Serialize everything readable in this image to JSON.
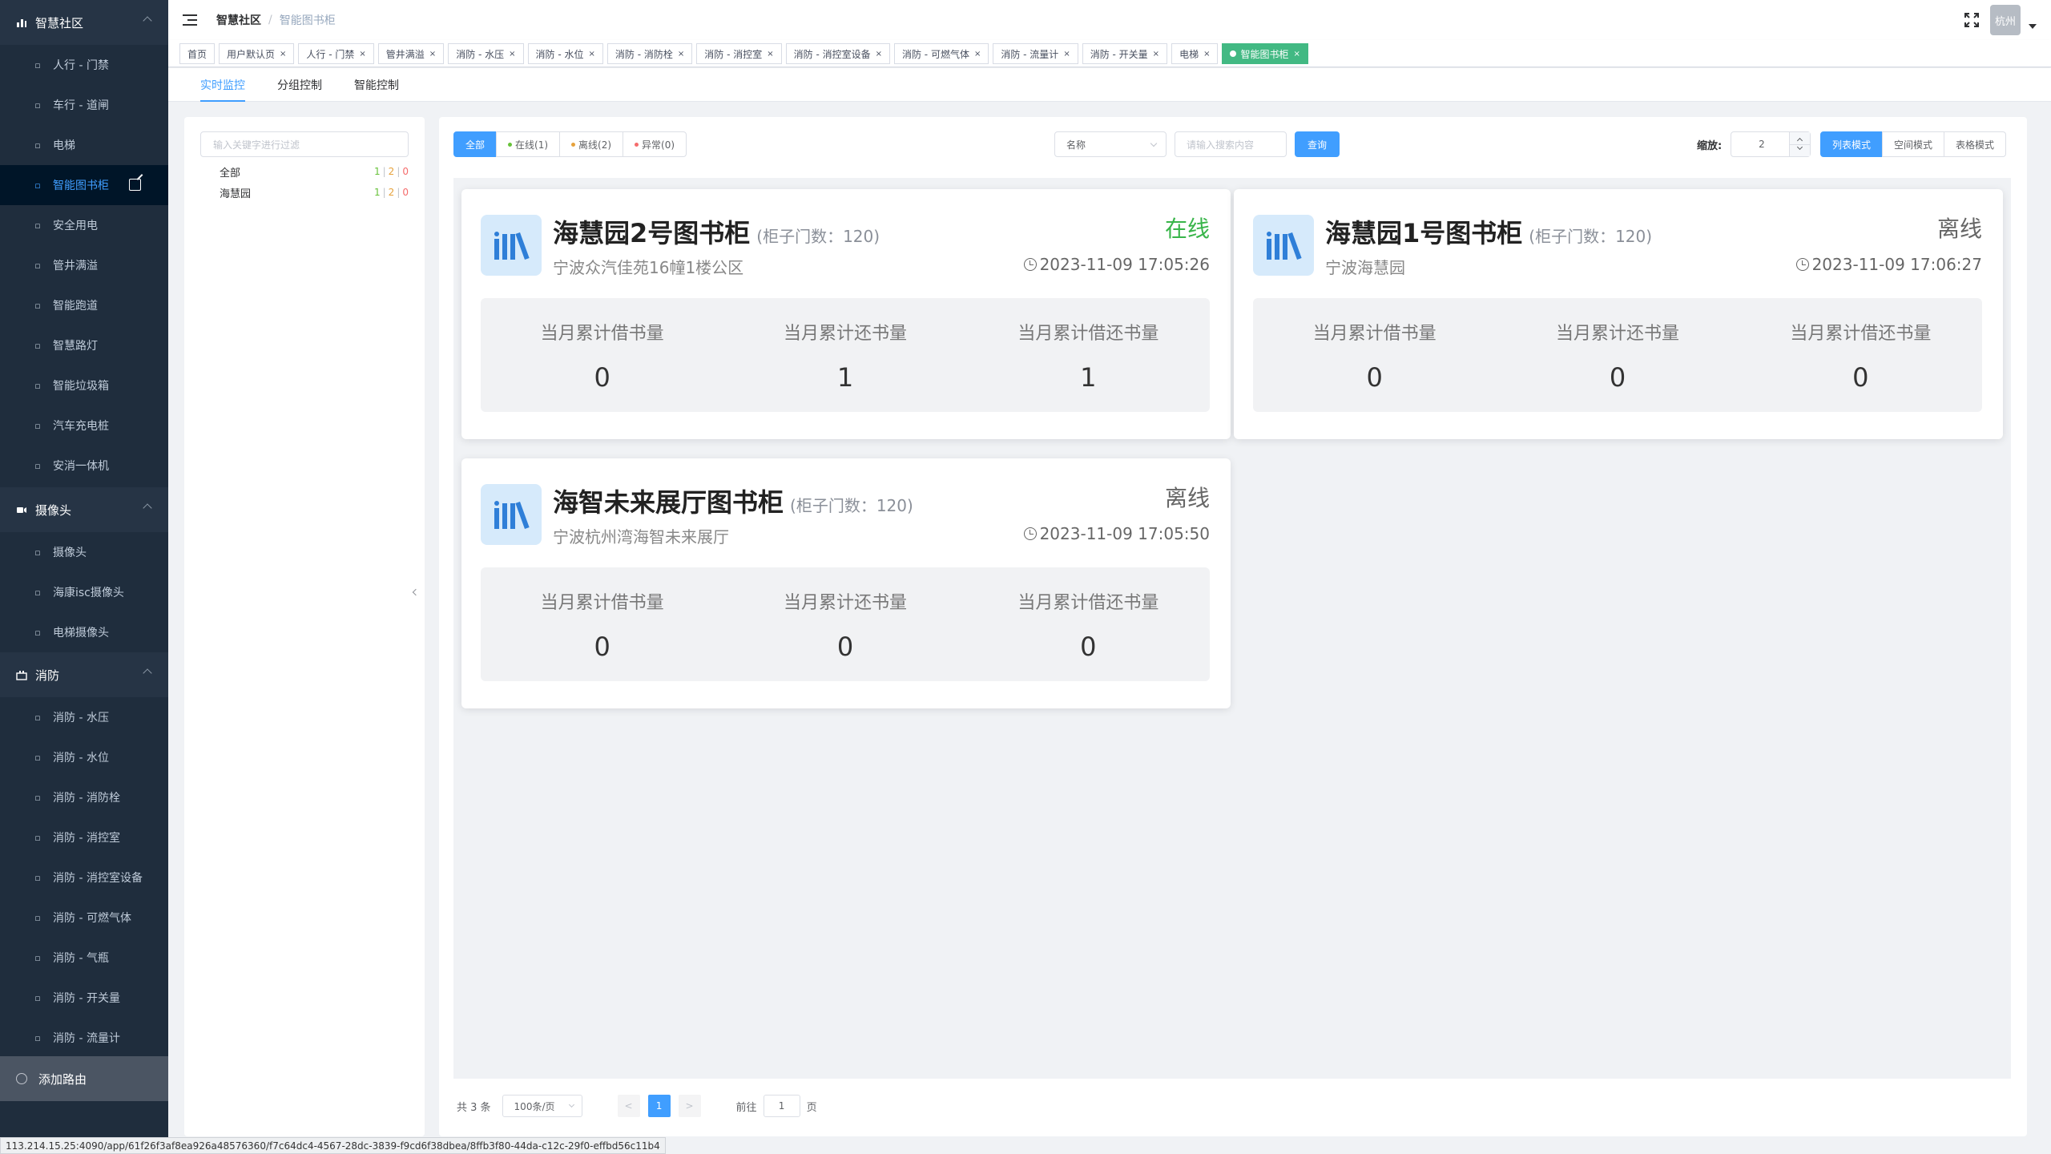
{
  "sidebar": {
    "groups": [
      {
        "label": "智慧社区",
        "icon": "bar-chart-icon"
      },
      {
        "label": "摄像头",
        "icon": "camera-icon"
      },
      {
        "label": "消防",
        "icon": "fire-icon"
      }
    ],
    "community_items": [
      {
        "label": "人行 - 门禁",
        "icon": "pedestrian-icon"
      },
      {
        "label": "车行 - 道闸",
        "icon": "car-icon"
      },
      {
        "label": "电梯",
        "icon": "elevator-icon"
      },
      {
        "label": "智能图书柜",
        "icon": "books-icon"
      },
      {
        "label": "安全用电",
        "icon": "plug-icon"
      },
      {
        "label": "管井满溢",
        "icon": "well-icon"
      },
      {
        "label": "智能跑道",
        "icon": "runner-icon"
      },
      {
        "label": "智慧路灯",
        "icon": "lamp-icon"
      },
      {
        "label": "智能垃圾箱",
        "icon": "trash-icon"
      },
      {
        "label": "汽车充电桩",
        "icon": "charger-icon"
      },
      {
        "label": "安消一体机",
        "icon": "device-icon"
      }
    ],
    "camera_items": [
      {
        "label": "摄像头",
        "icon": "camera-icon"
      },
      {
        "label": "海康isc摄像头",
        "icon": "camera-icon"
      },
      {
        "label": "电梯摄像头",
        "icon": "elevator-icon"
      }
    ],
    "fire_items": [
      {
        "label": "消防 - 水压",
        "icon": "gauge-icon"
      },
      {
        "label": "消防 - 水位",
        "icon": "water-level-icon"
      },
      {
        "label": "消防 - 消防栓",
        "icon": "hydrant-icon"
      },
      {
        "label": "消防 - 消控室",
        "icon": "home-icon"
      },
      {
        "label": "消防 - 消控室设备",
        "icon": "home-icon"
      },
      {
        "label": "消防 - 可燃气体",
        "icon": "gas-icon"
      },
      {
        "label": "消防 - 气瓶",
        "icon": "cylinder-icon"
      },
      {
        "label": "消防 - 开关量",
        "icon": "switch-icon"
      },
      {
        "label": "消防 - 流量计",
        "icon": "flow-icon"
      }
    ],
    "add_route": "添加路由"
  },
  "navbar": {
    "breadcrumb_root": "智慧社区",
    "breadcrumb_current": "智能图书柜",
    "avatar_text": "杭州"
  },
  "tags": [
    {
      "label": "首页",
      "closable": false
    },
    {
      "label": "用户默认页",
      "closable": true
    },
    {
      "label": "人行 - 门禁",
      "closable": true
    },
    {
      "label": "管井满溢",
      "closable": true
    },
    {
      "label": "消防 - 水压",
      "closable": true
    },
    {
      "label": "消防 - 水位",
      "closable": true
    },
    {
      "label": "消防 - 消防栓",
      "closable": true
    },
    {
      "label": "消防 - 消控室",
      "closable": true
    },
    {
      "label": "消防 - 消控室设备",
      "closable": true
    },
    {
      "label": "消防 - 可燃气体",
      "closable": true
    },
    {
      "label": "消防 - 流量计",
      "closable": true
    },
    {
      "label": "消防 - 开关量",
      "closable": true
    },
    {
      "label": "电梯",
      "closable": true
    },
    {
      "label": "智能图书柜",
      "closable": true,
      "active": true
    }
  ],
  "subtabs": [
    "实时监控",
    "分组控制",
    "智能控制"
  ],
  "tree": {
    "filter_placeholder": "输入关键字进行过滤",
    "nodes": [
      {
        "label": "全部",
        "online": "1",
        "offline": "2",
        "error": "0"
      },
      {
        "label": "海慧园",
        "online": "1",
        "offline": "2",
        "error": "0"
      }
    ]
  },
  "toolbar": {
    "status_filters": [
      {
        "label": "全部",
        "active": true
      },
      {
        "label": "在线(1)",
        "dot": "#67c23a"
      },
      {
        "label": "离线(2)",
        "dot": "#e6a23c"
      },
      {
        "label": "异常(0)",
        "dot": "#f56c6c"
      }
    ],
    "field_select": "名称",
    "search_placeholder": "请输入搜索内容",
    "query_button": "查询",
    "zoom_label": "缩放:",
    "zoom_value": "2",
    "modes": [
      {
        "label": "列表模式",
        "active": true
      },
      {
        "label": "空间模式"
      },
      {
        "label": "表格模式"
      }
    ]
  },
  "cards": [
    {
      "name": "海慧园2号图书柜",
      "doors": "(柜子门数：120)",
      "address": "宁波众汽佳苑16幢1楼公区",
      "status": "在线",
      "online": true,
      "time": "2023-11-09 17:05:26",
      "stats": [
        {
          "label": "当月累计借书量",
          "value": "0"
        },
        {
          "label": "当月累计还书量",
          "value": "1"
        },
        {
          "label": "当月累计借还书量",
          "value": "1"
        }
      ]
    },
    {
      "name": "海慧园1号图书柜",
      "doors": "(柜子门数：120)",
      "address": "宁波海慧园",
      "status": "离线",
      "online": false,
      "time": "2023-11-09 17:06:27",
      "stats": [
        {
          "label": "当月累计借书量",
          "value": "0"
        },
        {
          "label": "当月累计还书量",
          "value": "0"
        },
        {
          "label": "当月累计借还书量",
          "value": "0"
        }
      ]
    },
    {
      "name": "海智未来展厅图书柜",
      "doors": "(柜子门数：120)",
      "address": "宁波杭州湾海智未来展厅",
      "status": "离线",
      "online": false,
      "time": "2023-11-09 17:05:50",
      "stats": [
        {
          "label": "当月累计借书量",
          "value": "0"
        },
        {
          "label": "当月累计还书量",
          "value": "0"
        },
        {
          "label": "当月累计借还书量",
          "value": "0"
        }
      ]
    }
  ],
  "pagination": {
    "total": "共 3 条",
    "page_size": "100条/页",
    "prev": "<",
    "current": "1",
    "next": ">",
    "goto_prefix": "前往",
    "goto_value": "1",
    "goto_suffix": "页"
  },
  "status_url": "113.214.15.25:4090/app/61f26f3af8ea926a48576360/f7c64dc4-4567-28dc-3839-f9cd6f38dbea/8ffb3f80-44da-c12c-29f0-effbd56c11b4",
  "colors": {
    "sidebar_bg": "#1f2d3d",
    "primary": "#409eff",
    "active_tag": "#42b983",
    "online": "#39b54a"
  }
}
